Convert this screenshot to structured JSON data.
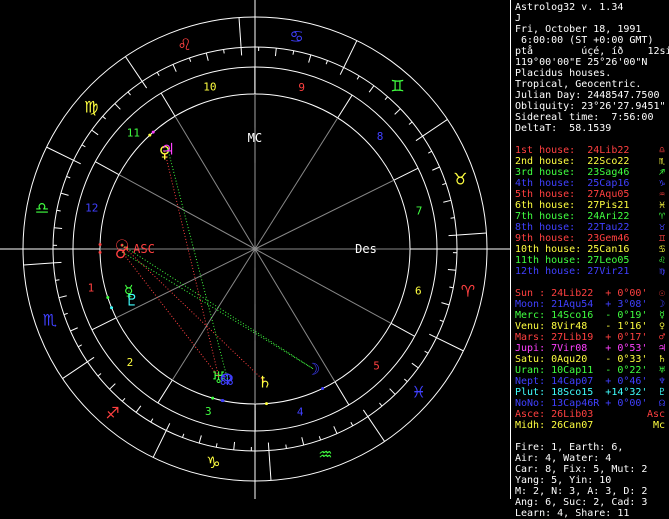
{
  "header": [
    "Astrolog32 v. 1.34",
    "J",
    "Fri, October 18, 1991",
    " 6:00:00 (ST +0:00 GMT)",
    "ptå        úçé, íð    12sign1",
    "119°00'00\"E 25°26'00\"N",
    "Placidus houses.",
    "Tropical, Geocentric.",
    "Julian Day: 2448547.7500",
    "Obliquity: 23°26'27.9451\"",
    "Sidereal time:  7:56:00",
    "DeltaT:  58.1539"
  ],
  "houses": [
    {
      "label": "1st house:",
      "value": "24Lib22",
      "color": "#ff4040",
      "glyph": "♎"
    },
    {
      "label": "2nd house:",
      "value": "22Sco22",
      "color": "#ffff40",
      "glyph": "♏"
    },
    {
      "label": "3rd house:",
      "value": "23Sag46",
      "color": "#40ff40",
      "glyph": "♐"
    },
    {
      "label": "4th house:",
      "value": "25Cap16",
      "color": "#4040ff",
      "glyph": "♑"
    },
    {
      "label": "5th house:",
      "value": "27Aqu05",
      "color": "#ff4040",
      "glyph": "♒"
    },
    {
      "label": "6th house:",
      "value": "27Pis21",
      "color": "#ffff40",
      "glyph": "♓"
    },
    {
      "label": "7th house:",
      "value": "24Ari22",
      "color": "#40ff40",
      "glyph": "♈"
    },
    {
      "label": "8th house:",
      "value": "22Tau22",
      "color": "#4040ff",
      "glyph": "♉"
    },
    {
      "label": "9th house:",
      "value": "23Gem46",
      "color": "#ff4040",
      "glyph": "♊"
    },
    {
      "label": "10th house:",
      "value": "25Can16",
      "color": "#ffff40",
      "glyph": "♋"
    },
    {
      "label": "11th house:",
      "value": "27Leo05",
      "color": "#40ff40",
      "glyph": "♌"
    },
    {
      "label": "12th house:",
      "value": "27Vir21",
      "color": "#4040ff",
      "glyph": "♍"
    }
  ],
  "planets": [
    {
      "name": "Sun :",
      "pos": "24Lib22",
      "decl": "+ 0°00'",
      "color": "#ff4040",
      "glyph": "☉"
    },
    {
      "name": "Moon:",
      "pos": "21Aqu54",
      "decl": "+ 3°08'",
      "color": "#4040ff",
      "glyph": "☽"
    },
    {
      "name": "Merc:",
      "pos": "14Sco16",
      "decl": "- 0°19'",
      "color": "#40ff40",
      "glyph": "☿"
    },
    {
      "name": "Venu:",
      "pos": "8Vir48",
      "decl": "- 1°16'",
      "color": "#ffff40",
      "glyph": "♀"
    },
    {
      "name": "Mars:",
      "pos": "27Lib19",
      "decl": "+ 0°17'",
      "color": "#ff4040",
      "glyph": "♂"
    },
    {
      "name": "Jupi:",
      "pos": "7Vir08",
      "decl": "+ 0°53'",
      "color": "#ff40ff",
      "glyph": "♃"
    },
    {
      "name": "Satu:",
      "pos": "0Aqu20",
      "decl": "- 0°33'",
      "color": "#ffff40",
      "glyph": "♄"
    },
    {
      "name": "Uran:",
      "pos": "10Cap11",
      "decl": "- 0°22'",
      "color": "#40ff40",
      "glyph": "♅"
    },
    {
      "name": "Nept:",
      "pos": "14Cap07",
      "decl": "+ 0°46'",
      "color": "#4040ff",
      "glyph": "♆"
    },
    {
      "name": "Plut:",
      "pos": "18Sco15",
      "decl": "+14°32'",
      "color": "#40ffff",
      "glyph": "♇"
    },
    {
      "name": "NoNo:",
      "pos": "13Cap46R",
      "decl": "+ 0°00'",
      "color": "#4040ff",
      "glyph": "☊"
    },
    {
      "name": "Asce:",
      "pos": "26Lib03",
      "decl": "",
      "color": "#ff4040",
      "glyph": "Asc"
    },
    {
      "name": "Midh:",
      "pos": "26Can07",
      "decl": "",
      "color": "#ffff40",
      "glyph": "Mc"
    }
  ],
  "stats": [
    "Fire: 1, Earth: 6,",
    "Air: 4, Water: 4",
    "Car: 8, Fix: 5, Mut: 2",
    "Yang: 5, Yin: 10",
    "M: 2, N: 3, A: 3, D: 2",
    "Ang: 6, Suc: 2, Cad: 3",
    "Learn: 4, Share: 11"
  ],
  "wheel": {
    "signs": [
      {
        "glyph": "♈",
        "color": "#ff4040"
      },
      {
        "glyph": "♉",
        "color": "#ffff40"
      },
      {
        "glyph": "♊",
        "color": "#40ff40"
      },
      {
        "glyph": "♋",
        "color": "#4040ff"
      },
      {
        "glyph": "♌",
        "color": "#ff4040"
      },
      {
        "glyph": "♍",
        "color": "#ffff40"
      },
      {
        "glyph": "♎",
        "color": "#40ff40"
      },
      {
        "glyph": "♏",
        "color": "#4040ff"
      },
      {
        "glyph": "♐",
        "color": "#ff4040"
      },
      {
        "glyph": "♑",
        "color": "#ffff40"
      },
      {
        "glyph": "♒",
        "color": "#40ff40"
      },
      {
        "glyph": "♓",
        "color": "#4040ff"
      }
    ],
    "house_numbers": [
      "1",
      "2",
      "3",
      "4",
      "5",
      "6",
      "7",
      "8",
      "9",
      "10",
      "11",
      "12"
    ],
    "angle_labels": {
      "asc": "ASC",
      "mc": "MC",
      "des": "Des"
    },
    "ascendant_lon": 206.05
  }
}
